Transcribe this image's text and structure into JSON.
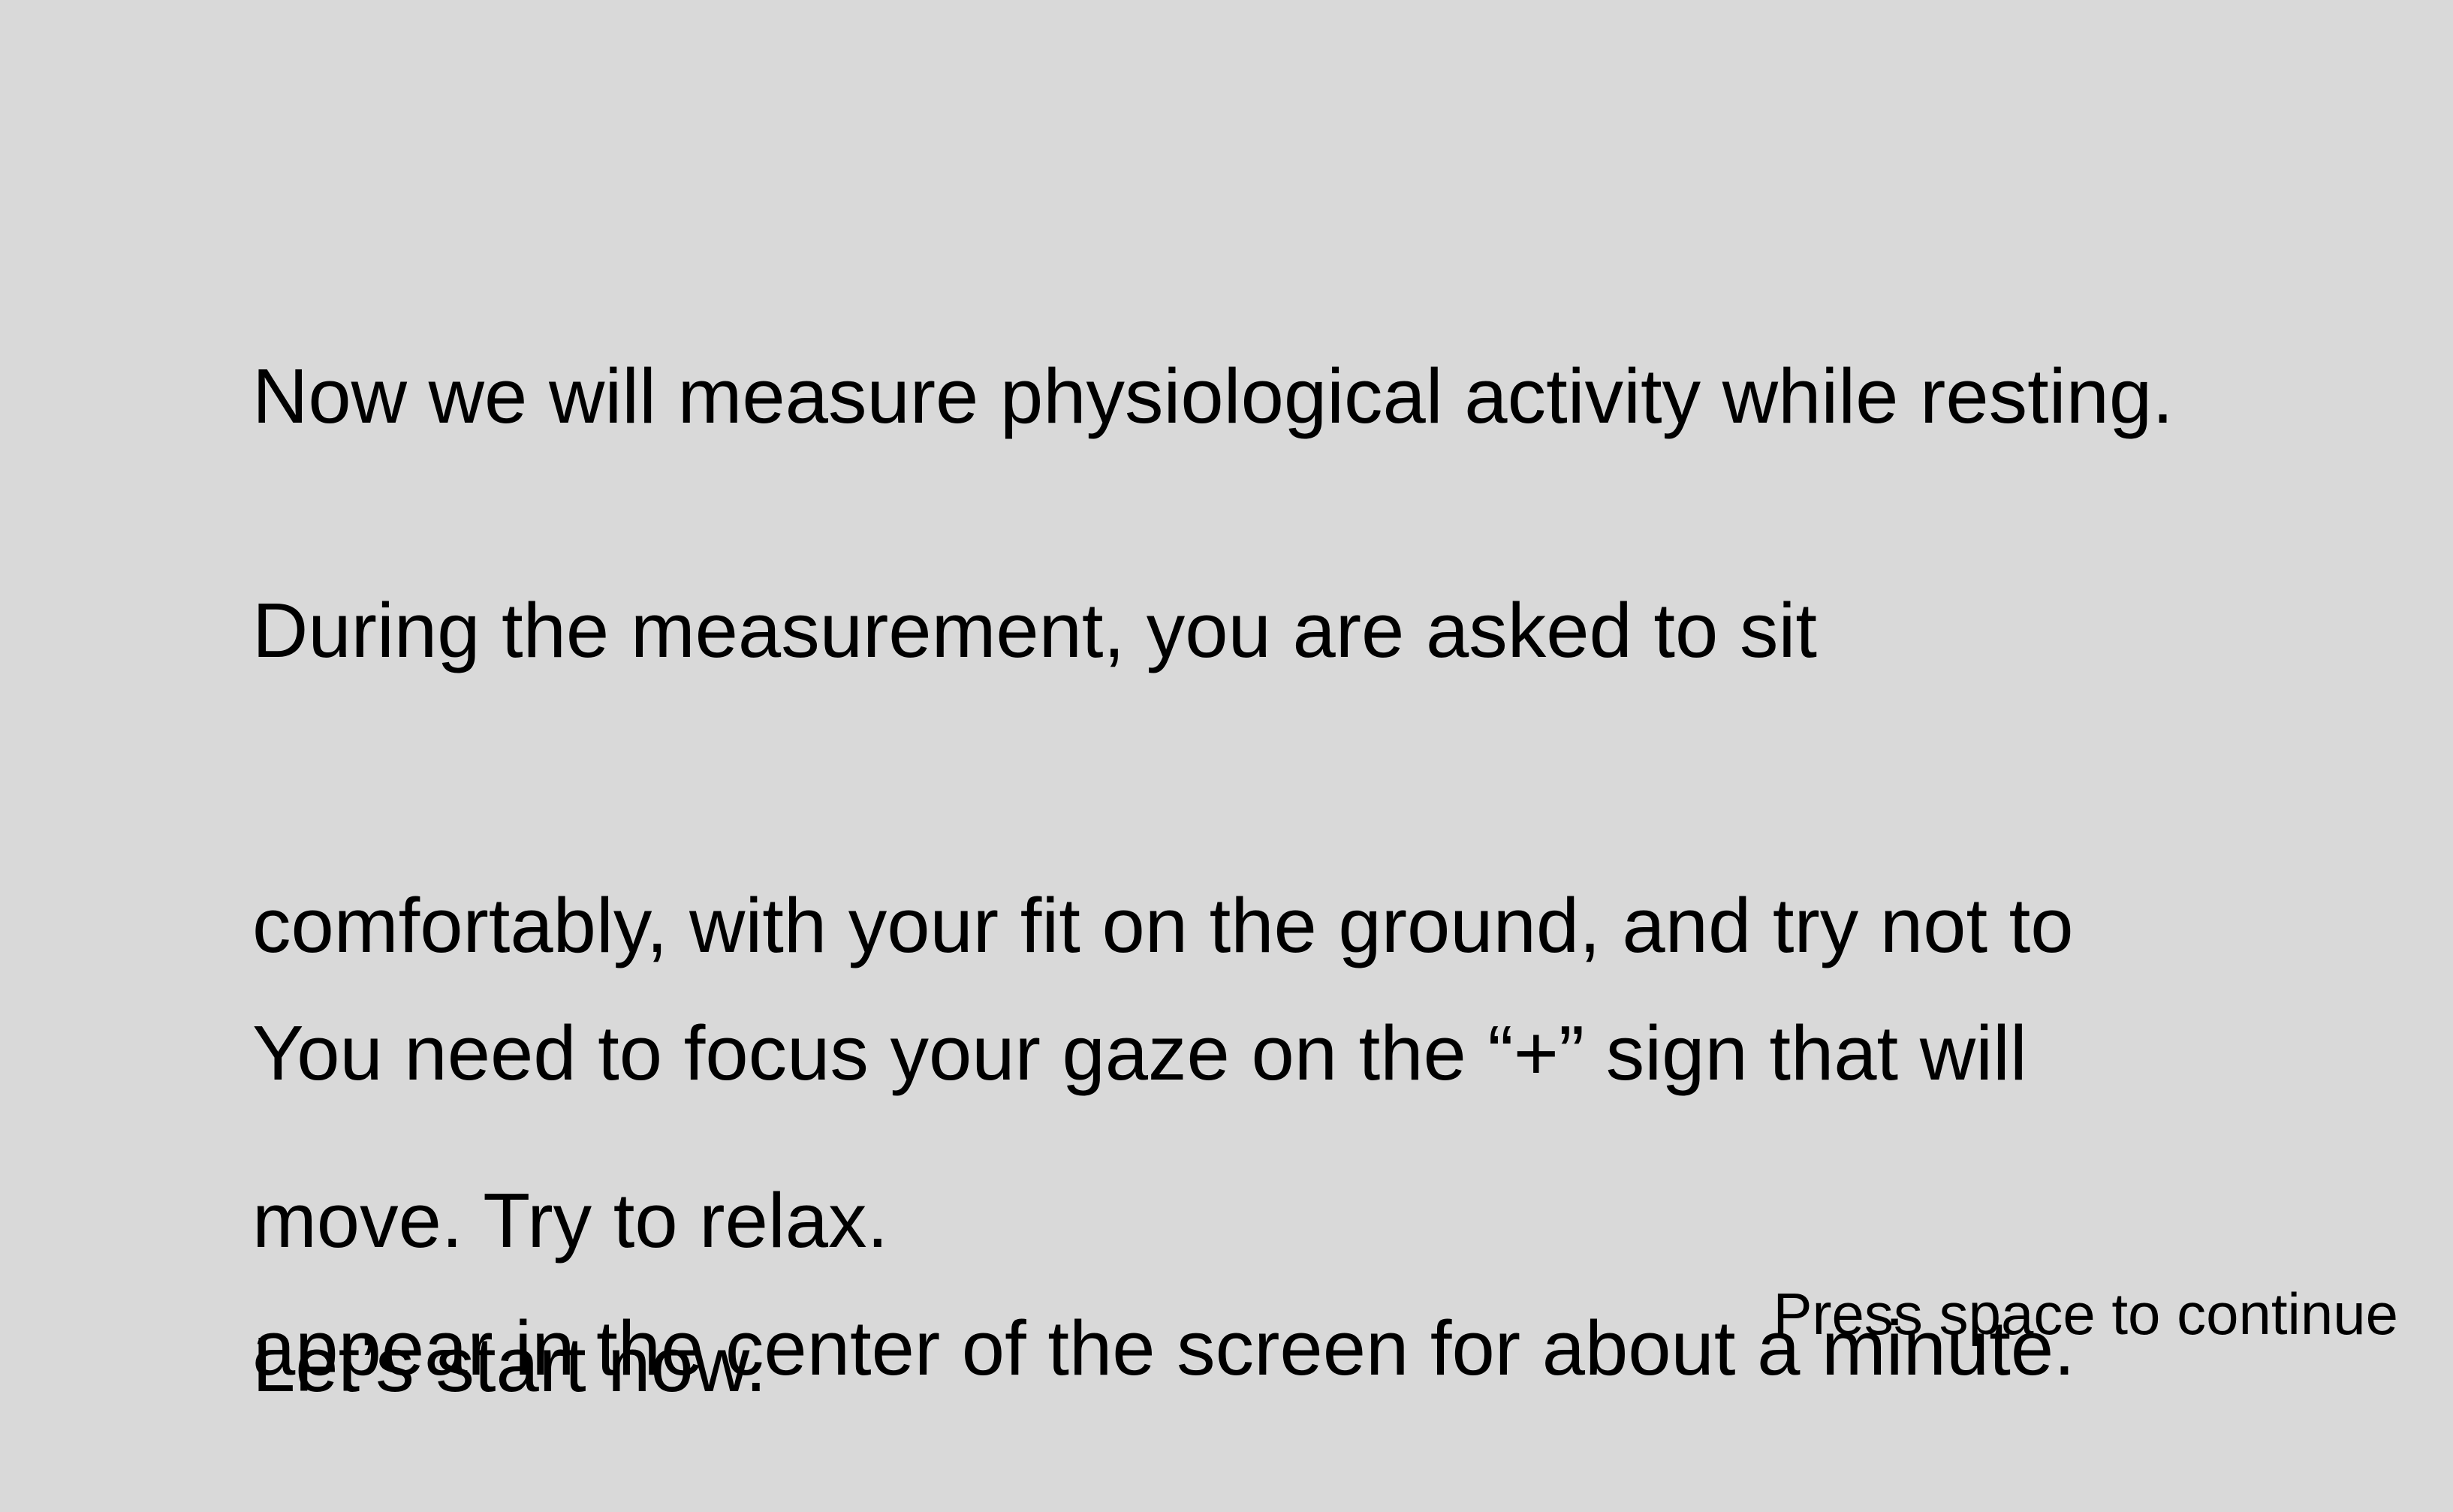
{
  "instructions": {
    "paragraph_1": [
      "Now we will measure physiological activity while resting."
    ],
    "paragraph_2": [
      "During the measurement, you are asked to sit",
      "comfortably, with your fit on the ground, and try not to",
      "move. Try to relax."
    ],
    "paragraph_3": [
      "You need to focus your gaze on the “+” sign that will",
      "appear in the center of the screen for about a minute."
    ],
    "paragraph_4": [
      "Let’s start now."
    ]
  },
  "footer": {
    "continue_prompt": "Press space to continue"
  },
  "colors": {
    "background": "#d9d9d9",
    "text": "#000000"
  }
}
